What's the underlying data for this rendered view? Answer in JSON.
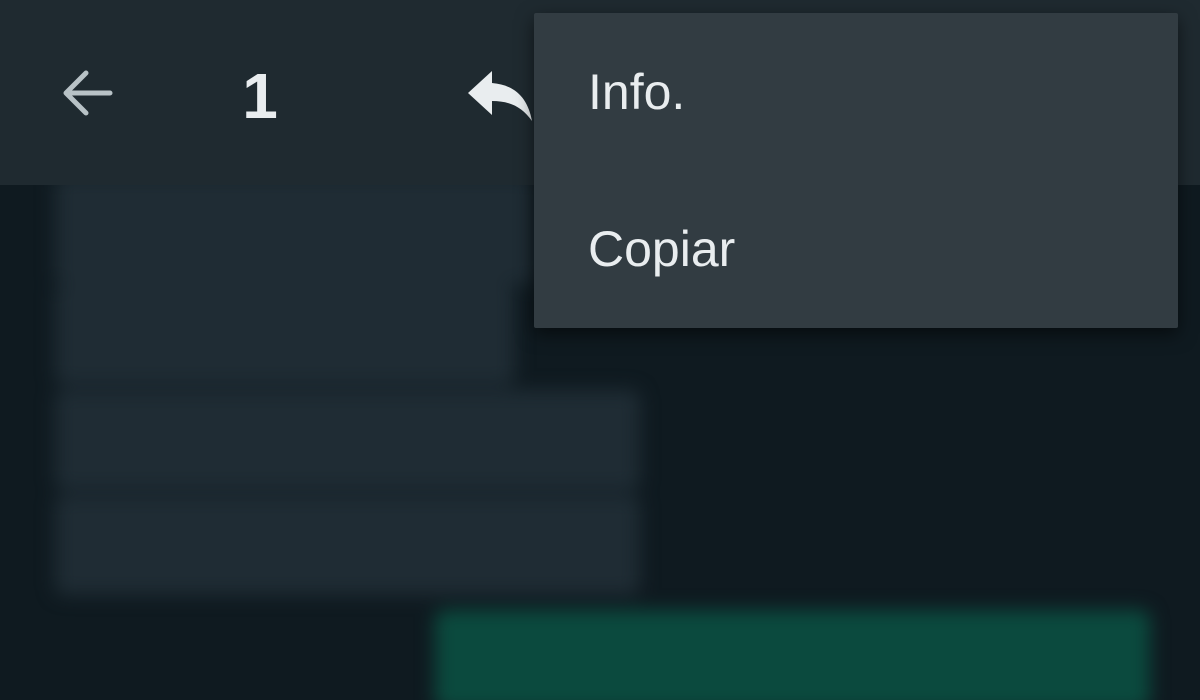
{
  "toolbar": {
    "back_icon": "arrow-left-icon",
    "selected_count": "1",
    "reply_icon": "reply-icon"
  },
  "menu": {
    "items": [
      {
        "label": "Info."
      },
      {
        "label": "Copiar"
      }
    ]
  },
  "colors": {
    "toolbar_bg": "#1f2a30",
    "chat_bg": "#0f1a20",
    "menu_bg": "#323c42",
    "text": "#e9edef",
    "incoming_bubble": "#1f2c34",
    "outgoing_bubble": "#0b4a3e"
  }
}
